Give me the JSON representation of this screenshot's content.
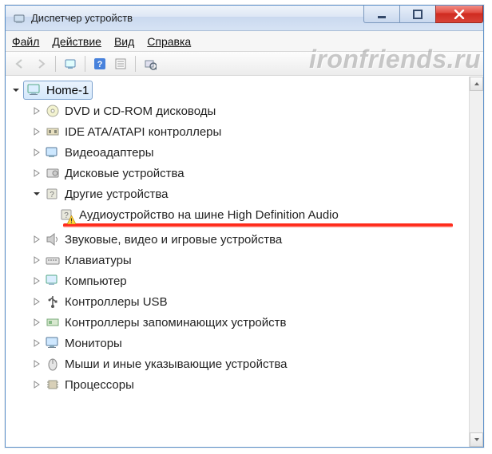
{
  "window": {
    "title": "Диспетчер устройств"
  },
  "menu": {
    "file": "Файл",
    "action": "Действие",
    "view": "Вид",
    "help": "Справка"
  },
  "watermark": "ironfriends.ru",
  "tree": {
    "root": "Home-1",
    "dvd": "DVD и CD-ROM дисководы",
    "ide": "IDE ATA/ATAPI контроллеры",
    "video": "Видеоадаптеры",
    "disk": "Дисковые устройства",
    "other": "Другие устройства",
    "otherChild": "Аудиоустройство на шине High Definition Audio",
    "sound": "Звуковые, видео и игровые устройства",
    "keyboard": "Клавиатуры",
    "computer": "Компьютер",
    "usb": "Контроллеры USB",
    "storage": "Контроллеры запоминающих устройств",
    "monitor": "Мониторы",
    "mouse": "Мыши и иные указывающие устройства",
    "cpu": "Процессоры"
  }
}
